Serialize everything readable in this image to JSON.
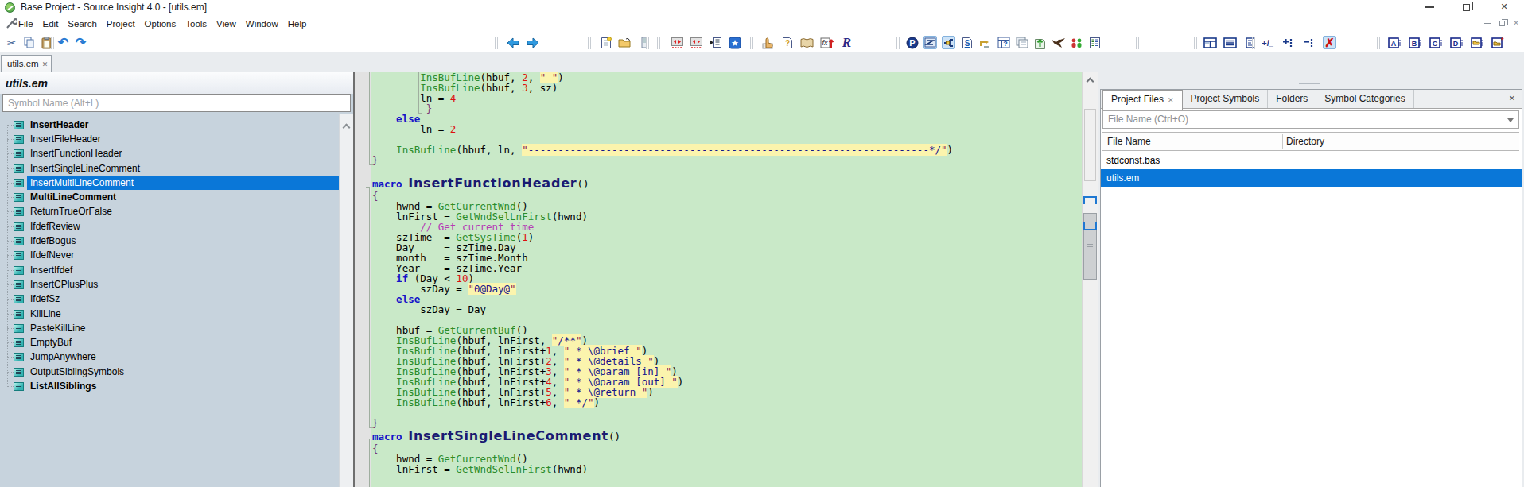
{
  "window": {
    "title": "Base Project - Source Insight 4.0 - [utils.em]",
    "controls": [
      "minimize",
      "restore",
      "close"
    ],
    "mdi_controls": [
      "minimize",
      "restore",
      "close"
    ]
  },
  "menu": {
    "items": [
      "File",
      "Edit",
      "Search",
      "Project",
      "Options",
      "Tools",
      "View",
      "Window",
      "Help"
    ]
  },
  "toolbar": {
    "groups": [
      [
        "cut",
        "copy",
        "paste"
      ],
      [
        "undo",
        "redo"
      ],
      [
        "back",
        "forward"
      ],
      [
        "new-file",
        "open-file",
        "save-file"
      ],
      [
        "sync-window",
        "sync-symbol",
        "goto-line",
        "favorites"
      ],
      [
        "browse-hand",
        "help-doc",
        "open-book",
        "function-index",
        "r-script"
      ],
      [
        "parse-file",
        "relation-window",
        "symbol-tree",
        "style-sheet",
        "link-window",
        "help-panel",
        "window-list",
        "export-doc",
        "eagle",
        "compare-files",
        "doc-list"
      ],
      [
        "table-view",
        "list-view",
        "detail-view"
      ],
      [
        "toggle-plus-minus",
        "add-line",
        "remove-line",
        "clear-highlight"
      ],
      [
        "draft-a",
        "draft-b",
        "draft-c",
        "draft-d",
        "folder-view",
        "folder-new"
      ]
    ],
    "pressed": [
      "relation-window",
      "symbol-tree",
      "clear-highlight"
    ]
  },
  "tabbar": {
    "document_tab": "utils.em",
    "close_glyph": "✕"
  },
  "left_panel": {
    "header": "utils.em",
    "search_placeholder": "Symbol Name (Alt+L)",
    "symbols": [
      {
        "label": "InsertHeader",
        "bold": true,
        "selected": false
      },
      {
        "label": "InsertFileHeader",
        "bold": false,
        "selected": false
      },
      {
        "label": "InsertFunctionHeader",
        "bold": false,
        "selected": false
      },
      {
        "label": "InsertSingleLineComment",
        "bold": false,
        "selected": false
      },
      {
        "label": "InsertMultiLineComment",
        "bold": false,
        "selected": true
      },
      {
        "label": "MultiLineComment",
        "bold": true,
        "selected": false
      },
      {
        "label": "ReturnTrueOrFalse",
        "bold": false,
        "selected": false
      },
      {
        "label": "IfdefReview",
        "bold": false,
        "selected": false
      },
      {
        "label": "IfdefBogus",
        "bold": false,
        "selected": false
      },
      {
        "label": "IfdefNever",
        "bold": false,
        "selected": false
      },
      {
        "label": "InsertIfdef",
        "bold": false,
        "selected": false
      },
      {
        "label": "InsertCPlusPlus",
        "bold": false,
        "selected": false
      },
      {
        "label": "IfdefSz",
        "bold": false,
        "selected": false
      },
      {
        "label": "KillLine",
        "bold": false,
        "selected": false
      },
      {
        "label": "PasteKillLine",
        "bold": false,
        "selected": false
      },
      {
        "label": "EmptyBuf",
        "bold": false,
        "selected": false
      },
      {
        "label": "JumpAnywhere",
        "bold": false,
        "selected": false
      },
      {
        "label": "OutputSiblingSymbols",
        "bold": false,
        "selected": false
      },
      {
        "label": "ListAllSiblings",
        "bold": true,
        "selected": false
      }
    ]
  },
  "editor": {
    "colors": {
      "background": "#c9e9c8",
      "string_bg": "#fbf4ad",
      "keyword": "#1414c8",
      "function": "#2c8c2c",
      "number": "#dd1111",
      "comment": "#b53ab5",
      "string": "#16168c",
      "selection": "#0a77d8"
    },
    "lines": [
      {
        "seg": [
          [
            "p",
            "        "
          ],
          [
            "f",
            "InsBufLine"
          ],
          [
            "p",
            "(hbuf, "
          ],
          [
            "n",
            "2"
          ],
          [
            "p",
            ", "
          ],
          [
            "q",
            "\""
          ],
          [
            "s",
            " "
          ],
          [
            "q",
            "\""
          ],
          [
            "p",
            ")"
          ]
        ]
      },
      {
        "seg": [
          [
            "p",
            "        "
          ],
          [
            "f",
            "InsBufLine"
          ],
          [
            "p",
            "(hbuf, "
          ],
          [
            "n",
            "3"
          ],
          [
            "p",
            ", sz)"
          ]
        ]
      },
      {
        "seg": [
          [
            "p",
            "        ln = "
          ],
          [
            "n",
            "4"
          ]
        ]
      },
      {
        "seg": [
          [
            "b",
            "         }"
          ]
        ]
      },
      {
        "seg": [
          [
            "p",
            "    "
          ],
          [
            "k",
            "else"
          ]
        ]
      },
      {
        "seg": [
          [
            "p",
            "        ln = "
          ],
          [
            "n",
            "2"
          ]
        ]
      },
      {
        "seg": []
      },
      {
        "seg": [
          [
            "p",
            "    "
          ],
          [
            "f",
            "InsBufLine"
          ],
          [
            "p",
            "(hbuf, ln, "
          ],
          [
            "q",
            "\""
          ],
          [
            "s",
            "-------------------------------------------------------------------*/"
          ],
          [
            "q",
            "\""
          ],
          [
            "p",
            ")"
          ]
        ]
      },
      {
        "seg": [
          [
            "b",
            "}"
          ]
        ]
      },
      {
        "seg": []
      },
      {
        "big": true,
        "seg": [
          [
            "k",
            "macro "
          ],
          [
            "g",
            "InsertFunctionHeader"
          ],
          [
            "p",
            "()"
          ]
        ]
      },
      {
        "seg": [
          [
            "b",
            "{"
          ]
        ]
      },
      {
        "seg": [
          [
            "p",
            "    hwnd = "
          ],
          [
            "f",
            "GetCurrentWnd"
          ],
          [
            "p",
            "()"
          ]
        ]
      },
      {
        "seg": [
          [
            "p",
            "    lnFirst = "
          ],
          [
            "f",
            "GetWndSelLnFirst"
          ],
          [
            "p",
            "(hwnd)"
          ]
        ]
      },
      {
        "seg": [
          [
            "p",
            "        "
          ],
          [
            "c",
            "// Get current time"
          ]
        ]
      },
      {
        "seg": [
          [
            "p",
            "    szTime  = "
          ],
          [
            "f",
            "GetSysTime"
          ],
          [
            "p",
            "("
          ],
          [
            "n",
            "1"
          ],
          [
            "p",
            ")"
          ]
        ]
      },
      {
        "seg": [
          [
            "p",
            "    Day     = szTime.Day"
          ]
        ]
      },
      {
        "seg": [
          [
            "p",
            "    month   = szTime.Month"
          ]
        ]
      },
      {
        "seg": [
          [
            "p",
            "    Year    = szTime.Year"
          ]
        ]
      },
      {
        "seg": [
          [
            "p",
            "    "
          ],
          [
            "k",
            "if"
          ],
          [
            "p",
            " (Day < "
          ],
          [
            "n",
            "10"
          ],
          [
            "p",
            ")"
          ]
        ]
      },
      {
        "seg": [
          [
            "p",
            "        szDay = "
          ],
          [
            "q",
            "\""
          ],
          [
            "s",
            "0@Day@"
          ],
          [
            "q",
            "\""
          ]
        ]
      },
      {
        "seg": [
          [
            "p",
            "    "
          ],
          [
            "k",
            "else"
          ]
        ]
      },
      {
        "seg": [
          [
            "p",
            "        szDay = Day"
          ]
        ]
      },
      {
        "seg": []
      },
      {
        "seg": [
          [
            "p",
            "    hbuf = "
          ],
          [
            "f",
            "GetCurrentBuf"
          ],
          [
            "p",
            "()"
          ]
        ]
      },
      {
        "seg": [
          [
            "p",
            "    "
          ],
          [
            "f",
            "InsBufLine"
          ],
          [
            "p",
            "(hbuf, lnFirst, "
          ],
          [
            "q",
            "\""
          ],
          [
            "s",
            "/**"
          ],
          [
            "q",
            "\""
          ],
          [
            "p",
            ")"
          ]
        ]
      },
      {
        "seg": [
          [
            "p",
            "    "
          ],
          [
            "f",
            "InsBufLine"
          ],
          [
            "p",
            "(hbuf, lnFirst+"
          ],
          [
            "n",
            "1"
          ],
          [
            "p",
            ", "
          ],
          [
            "q",
            "\""
          ],
          [
            "s",
            " * \\@brief "
          ],
          [
            "q",
            "\""
          ],
          [
            "p",
            ")"
          ]
        ]
      },
      {
        "seg": [
          [
            "p",
            "    "
          ],
          [
            "f",
            "InsBufLine"
          ],
          [
            "p",
            "(hbuf, lnFirst+"
          ],
          [
            "n",
            "2"
          ],
          [
            "p",
            ", "
          ],
          [
            "q",
            "\""
          ],
          [
            "s",
            " * \\@details "
          ],
          [
            "q",
            "\""
          ],
          [
            "p",
            ")"
          ]
        ]
      },
      {
        "seg": [
          [
            "p",
            "    "
          ],
          [
            "f",
            "InsBufLine"
          ],
          [
            "p",
            "(hbuf, lnFirst+"
          ],
          [
            "n",
            "3"
          ],
          [
            "p",
            ", "
          ],
          [
            "q",
            "\""
          ],
          [
            "s",
            " * \\@param [in] "
          ],
          [
            "q",
            "\""
          ],
          [
            "p",
            ")"
          ]
        ]
      },
      {
        "seg": [
          [
            "p",
            "    "
          ],
          [
            "f",
            "InsBufLine"
          ],
          [
            "p",
            "(hbuf, lnFirst+"
          ],
          [
            "n",
            "4"
          ],
          [
            "p",
            ", "
          ],
          [
            "q",
            "\""
          ],
          [
            "s",
            " * \\@param [out] "
          ],
          [
            "q",
            "\""
          ],
          [
            "p",
            ")"
          ]
        ]
      },
      {
        "seg": [
          [
            "p",
            "    "
          ],
          [
            "f",
            "InsBufLine"
          ],
          [
            "p",
            "(hbuf, lnFirst+"
          ],
          [
            "n",
            "5"
          ],
          [
            "p",
            ", "
          ],
          [
            "q",
            "\""
          ],
          [
            "s",
            " * \\@return "
          ],
          [
            "q",
            "\""
          ],
          [
            "p",
            ")"
          ]
        ]
      },
      {
        "seg": [
          [
            "p",
            "    "
          ],
          [
            "f",
            "InsBufLine"
          ],
          [
            "p",
            "(hbuf, lnFirst+"
          ],
          [
            "n",
            "6"
          ],
          [
            "p",
            ", "
          ],
          [
            "q",
            "\""
          ],
          [
            "s",
            " */"
          ],
          [
            "q",
            "\""
          ],
          [
            "p",
            ")"
          ]
        ]
      },
      {
        "seg": []
      },
      {
        "seg": [
          [
            "b",
            "}"
          ]
        ]
      },
      {
        "big": true,
        "seg": [
          [
            "k",
            "macro "
          ],
          [
            "g",
            "InsertSingleLineComment"
          ],
          [
            "p",
            "()"
          ]
        ]
      },
      {
        "seg": [
          [
            "b",
            "{"
          ]
        ]
      },
      {
        "seg": [
          [
            "p",
            "    hwnd = "
          ],
          [
            "f",
            "GetCurrentWnd"
          ],
          [
            "p",
            "()"
          ]
        ]
      },
      {
        "seg": [
          [
            "p",
            "    lnFirst = "
          ],
          [
            "f",
            "GetWndSelLnFirst"
          ],
          [
            "p",
            "(hwnd)"
          ]
        ]
      }
    ]
  },
  "right_panel": {
    "tabs": [
      {
        "label": "Project Files",
        "active": true,
        "closable": true
      },
      {
        "label": "Project Symbols",
        "active": false,
        "closable": false
      },
      {
        "label": "Folders",
        "active": false,
        "closable": false
      },
      {
        "label": "Symbol Categories",
        "active": false,
        "closable": false
      }
    ],
    "combo_placeholder": "File Name (Ctrl+O)",
    "columns": [
      "File Name",
      "Directory"
    ],
    "rows": [
      {
        "file": "stdconst.bas",
        "directory": "",
        "selected": false
      },
      {
        "file": "utils.em",
        "directory": "",
        "selected": true
      }
    ]
  }
}
